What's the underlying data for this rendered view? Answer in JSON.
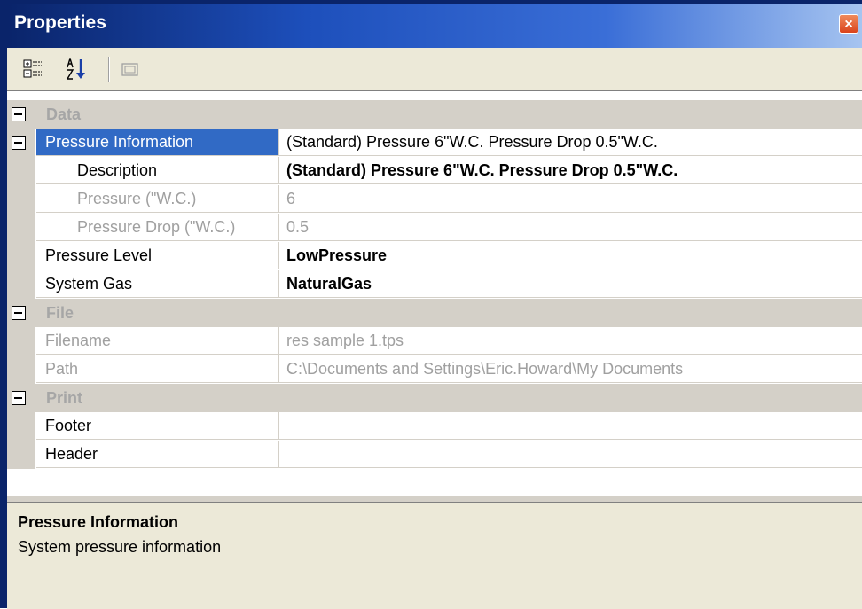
{
  "window": {
    "title": "Properties",
    "close_glyph": "×"
  },
  "toolbar": {
    "buttons": [
      {
        "name": "categorized-icon",
        "tooltip": "Categorized"
      },
      {
        "name": "alphabetical-icon",
        "tooltip": "Alphabetical"
      },
      {
        "name": "property-pages-icon",
        "tooltip": "Property Pages"
      }
    ]
  },
  "grid": {
    "categories": {
      "data": "Data",
      "file": "File",
      "print": "Print"
    },
    "rows": {
      "pressure_information": {
        "name": "Pressure Information",
        "value": "(Standard) Pressure 6\"W.C. Pressure Drop 0.5\"W.C."
      },
      "description": {
        "name": "Description",
        "value": "(Standard) Pressure 6\"W.C. Pressure Drop 0.5\"W.C."
      },
      "pressure": {
        "name": "Pressure (\"W.C.)",
        "value": "6"
      },
      "pressure_drop": {
        "name": "Pressure Drop (\"W.C.)",
        "value": "0.5"
      },
      "pressure_level": {
        "name": "Pressure Level",
        "value": "LowPressure"
      },
      "system_gas": {
        "name": "System Gas",
        "value": "NaturalGas"
      },
      "filename": {
        "name": "Filename",
        "value": "res sample 1.tps"
      },
      "path": {
        "name": "Path",
        "value": "C:\\Documents and Settings\\Eric.Howard\\My Documents"
      },
      "footer": {
        "name": "Footer",
        "value": ""
      },
      "header": {
        "name": "Header",
        "value": ""
      }
    }
  },
  "help": {
    "title": "Pressure Information",
    "description": "System pressure information"
  },
  "colors": {
    "selection": "#316ac5",
    "category_bg": "#d4d0c8",
    "disabled_text": "#a0a0a0"
  }
}
